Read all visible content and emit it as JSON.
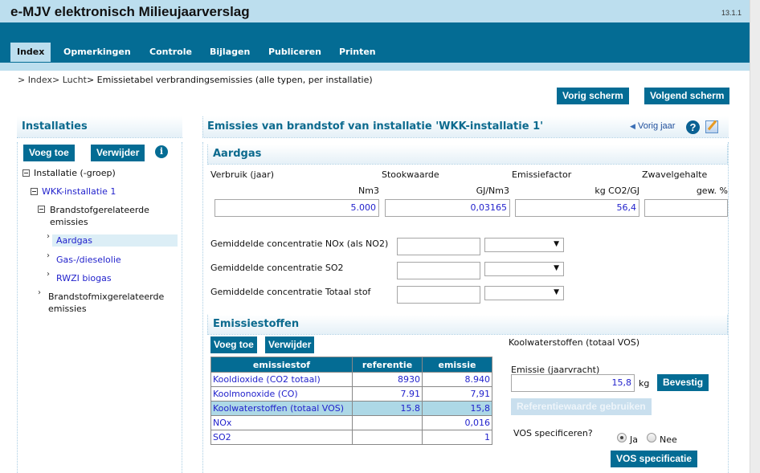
{
  "app": {
    "title": "e-MJV elektronisch Milieujaarverslag",
    "version": "13.1.1"
  },
  "nav": {
    "tabs": [
      {
        "label": "Index",
        "active": true
      },
      {
        "label": "Opmerkingen",
        "active": false
      },
      {
        "label": "Controle",
        "active": false
      },
      {
        "label": "Bijlagen",
        "active": false
      },
      {
        "label": "Publiceren",
        "active": false
      },
      {
        "label": "Printen",
        "active": false
      }
    ]
  },
  "breadcrumb": {
    "items": [
      "> Index",
      "> Lucht",
      "> Emissietabel verbrandingsemissies (alle typen, per installatie)"
    ]
  },
  "page_buttons": {
    "previous": "Vorig scherm",
    "next": "Volgend scherm"
  },
  "sidebar": {
    "title": "Installaties",
    "add_label": "Voeg toe",
    "remove_label": "Verwijder",
    "tree": [
      {
        "label": "Installatie (-groep)",
        "level": 0,
        "expanded": true
      },
      {
        "label": "WKK-installatie 1",
        "level": 1,
        "expanded": true
      },
      {
        "label": "Brandstofgerelateerde emissies",
        "level": 2,
        "expanded": true
      },
      {
        "label": "Aardgas",
        "level": 3,
        "selected": true
      },
      {
        "label": "Gas-/dieselolie",
        "level": 3
      },
      {
        "label": "RWZI biogas",
        "level": 3
      },
      {
        "label": "Brandstofmixgerelateerde emissies",
        "level": 2,
        "expanded": false
      }
    ]
  },
  "main": {
    "title": "Emissies van brandstof van installatie 'WKK-installatie 1'",
    "previous_year": "Vorig jaar",
    "fuel": {
      "title": "Aardgas",
      "fields": [
        {
          "label": "Verbruik (jaar)",
          "unit": "Nm3",
          "value": "5.000"
        },
        {
          "label": "Stookwaarde",
          "unit": "GJ/Nm3",
          "value": "0,03165"
        },
        {
          "label": "Emissiefactor",
          "unit": "kg CO2/GJ",
          "value": "56,4"
        },
        {
          "label": "Zwavelgehalte",
          "unit": "gew. %",
          "value": ""
        }
      ],
      "concentrations": [
        {
          "label": "Gemiddelde concentratie NOx (als NO2)",
          "value": "",
          "unit": ""
        },
        {
          "label": "Gemiddelde concentratie SO2",
          "value": "",
          "unit": ""
        },
        {
          "label": "Gemiddelde concentratie Totaal stof",
          "value": "",
          "unit": ""
        }
      ]
    },
    "substances": {
      "title": "Emissiestoffen",
      "add_label": "Voeg toe",
      "remove_label": "Verwijder",
      "columns": [
        "emissiestof",
        "referentie",
        "emissie"
      ],
      "rows": [
        {
          "name": "Kooldioxide (CO2 totaal)",
          "reference": "8930",
          "emission": "8.940",
          "selected": false
        },
        {
          "name": "Koolmonoxide (CO)",
          "reference": "7.91",
          "emission": "7,91",
          "selected": false
        },
        {
          "name": "Koolwaterstoffen (totaal VOS)",
          "reference": "15.8",
          "emission": "15,8",
          "selected": true
        },
        {
          "name": "NOx",
          "reference": "",
          "emission": "0,016",
          "selected": false
        },
        {
          "name": "SO2",
          "reference": "",
          "emission": "1",
          "selected": false
        }
      ]
    },
    "detail": {
      "title": "Koolwaterstoffen (totaal VOS)",
      "emission_label": "Emissie (jaarvracht)",
      "emission_value": "15,8",
      "emission_unit": "kg",
      "confirm_label": "Bevestig",
      "use_reference_label": "Referentiewaarde gebruiken",
      "specify_label": "VOS specificeren?",
      "radio_yes": "Ja",
      "radio_no": "Nee",
      "selected_option": "Ja",
      "specification_button": "VOS specificatie"
    }
  },
  "colors": {
    "brand": "#046c94",
    "header_light": "#bcdeee",
    "link": "#2222cc",
    "selected_row": "#add8e6"
  }
}
